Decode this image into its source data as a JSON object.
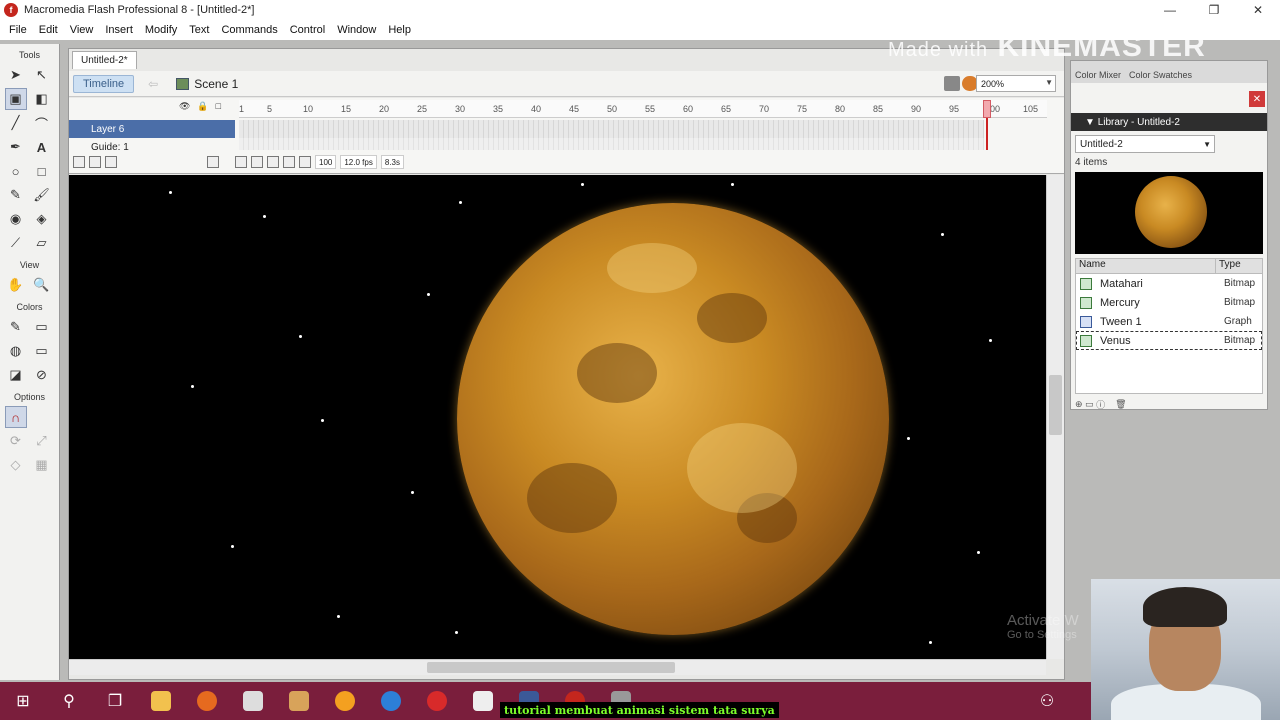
{
  "window": {
    "title": "Macromedia Flash Professional 8 - [Untitled-2*]",
    "minimize": "—",
    "maximize": "❐",
    "close": "✕"
  },
  "menu": [
    "File",
    "Edit",
    "View",
    "Insert",
    "Modify",
    "Text",
    "Commands",
    "Control",
    "Window",
    "Help"
  ],
  "tools": {
    "title": "Tools",
    "view_label": "View",
    "colors_label": "Colors",
    "options_label": "Options"
  },
  "document": {
    "tab": "Untitled-2*",
    "timeline_button": "Timeline",
    "scene": "Scene 1",
    "zoom": "200%",
    "frame_ticks": [
      "1",
      "5",
      "10",
      "15",
      "20",
      "25",
      "30",
      "35",
      "40",
      "45",
      "50",
      "55",
      "60",
      "65",
      "70",
      "75",
      "80",
      "85",
      "90",
      "95",
      "100",
      "105"
    ],
    "layers": [
      {
        "name": "Layer 6",
        "selected": true
      },
      {
        "name": "Guide: 1",
        "selected": false
      }
    ],
    "status": {
      "current_frame": "100",
      "fps": "12.0 fps",
      "time": "8.3s"
    }
  },
  "watermark": {
    "made_with": "Made with",
    "brand": "KINEMASTER"
  },
  "panels": {
    "color_mixer_tab": "Color Mixer",
    "color_swatches_tab": "Color Swatches",
    "library_title": "Library - Untitled-2",
    "library_doc": "Untitled-2",
    "item_count": "4 items",
    "columns": {
      "name": "Name",
      "type": "Type"
    },
    "items": [
      {
        "name": "Matahari",
        "type": "Bitmap",
        "icon": "bitmap-icon"
      },
      {
        "name": "Mercury",
        "type": "Bitmap",
        "icon": "bitmap-icon"
      },
      {
        "name": "Tween 1",
        "type": "Graph",
        "icon": "graphic-icon"
      },
      {
        "name": "Venus",
        "type": "Bitmap",
        "icon": "bitmap-icon",
        "selected": true
      }
    ]
  },
  "overlay": {
    "activate_line1": "Activate W",
    "activate_line2": "Go to Settings"
  },
  "caption": "tutorial membuat animasi sistem tata surya",
  "colors": {
    "taskbar": "#7a1e3c",
    "caption_text": "#7cff2a",
    "planet": "#c98a23"
  }
}
